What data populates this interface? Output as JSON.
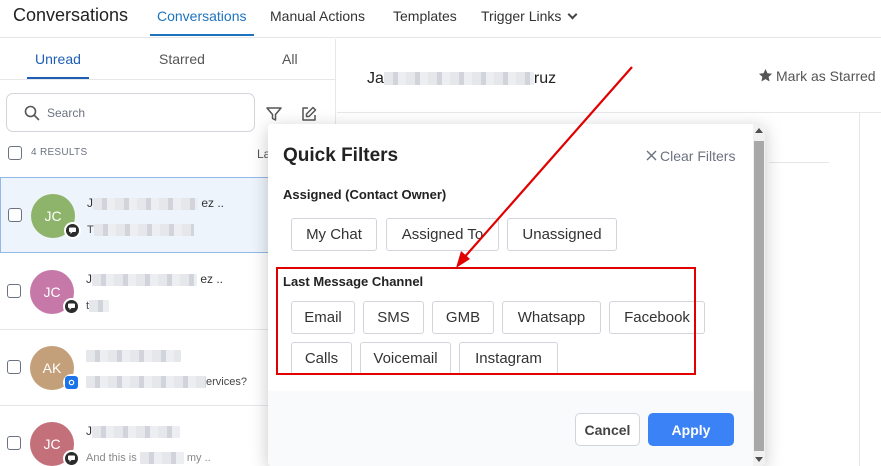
{
  "header": {
    "app_title": "Conversations",
    "nav": [
      {
        "label": "Conversations",
        "active": true
      },
      {
        "label": "Manual Actions"
      },
      {
        "label": "Templates"
      },
      {
        "label": "Trigger Links",
        "has_dropdown": true
      }
    ]
  },
  "left_panel": {
    "tabs": [
      {
        "label": "Unread",
        "active": true
      },
      {
        "label": "Starred"
      },
      {
        "label": "All"
      }
    ],
    "search": {
      "placeholder": "Search"
    },
    "results_label": "4 RESULTS",
    "sort_label_partial": "La",
    "conversations": [
      {
        "initials": "JC",
        "avatar_color": "#8db46a",
        "name_prefix": "J",
        "name_suffix": "ez ..",
        "preview_prefix": "T",
        "channel_icon": "chat-icon",
        "selected": true
      },
      {
        "initials": "JC",
        "avatar_color": "#c679a8",
        "name_prefix": "J",
        "name_suffix": "ez ..",
        "preview_prefix": "t",
        "channel_icon": "chat-icon",
        "selected": false
      },
      {
        "initials": "AK",
        "avatar_color": "#c4a07a",
        "name_prefix": "",
        "name_suffix": "",
        "preview_prefix": "",
        "preview_suffix": "ervices?",
        "channel_icon": "gmb-icon",
        "selected": false
      },
      {
        "initials": "JC",
        "avatar_color": "#c4707a",
        "name_prefix": "J",
        "name_suffix": "",
        "preview_prefix": "And this is",
        "preview_suffix": "my ..",
        "channel_icon": "chat-icon",
        "selected": false
      }
    ]
  },
  "right_panel": {
    "contact_name_prefix": "Ja",
    "contact_name_suffix": "ruz",
    "mark_starred_label": "Mark as Starred"
  },
  "quick_filters": {
    "title": "Quick Filters",
    "clear_label": "Clear Filters",
    "assigned_section": {
      "label": "Assigned (Contact Owner)",
      "options": [
        "My Chat",
        "Assigned To",
        "Unassigned"
      ]
    },
    "channel_section": {
      "label": "Last Message Channel",
      "options": [
        "Email",
        "SMS",
        "GMB",
        "Whatsapp",
        "Facebook",
        "Calls",
        "Voicemail",
        "Instagram"
      ]
    },
    "cancel_label": "Cancel",
    "apply_label": "Apply"
  },
  "colors": {
    "accent": "#1e73be",
    "apply_button": "#3b82f6",
    "annotation_red": "#e10000"
  }
}
